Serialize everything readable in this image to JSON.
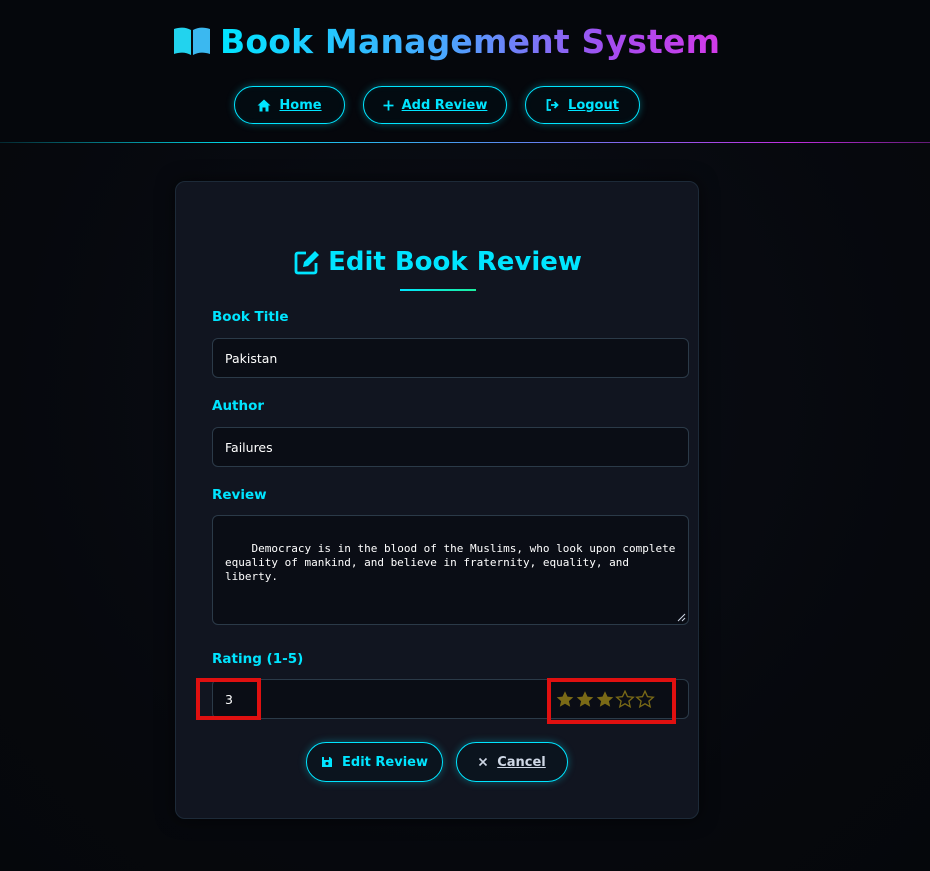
{
  "header": {
    "title": "Book Management System",
    "brand_icon": "open-book-icon",
    "nav": [
      {
        "label": "Home",
        "icon": "home-icon"
      },
      {
        "label": "Add Review",
        "icon": "plus-icon"
      },
      {
        "label": "Logout",
        "icon": "logout-icon"
      }
    ]
  },
  "form": {
    "title": "Edit Book Review",
    "title_icon": "edit-icon",
    "book_title": {
      "label": "Book Title",
      "value": "Pakistan"
    },
    "author": {
      "label": "Author",
      "value": "Failures"
    },
    "review": {
      "label": "Review",
      "value": "Democracy is in the blood of the Muslims, who look upon complete\nequality of mankind, and believe in fraternity, equality, and\nliberty."
    },
    "rating": {
      "label": "Rating (1-5)",
      "value": "3",
      "stars_filled": 3,
      "stars_total": 5
    },
    "submit_label": "Edit Review",
    "cancel_label": "Cancel"
  },
  "colors": {
    "accent": "#00e5ff",
    "brand_gradient_start": "#00e5ff",
    "brand_gradient_end": "#d23ae8",
    "star_filled": "#7a6a16",
    "highlight": "#e01010"
  }
}
